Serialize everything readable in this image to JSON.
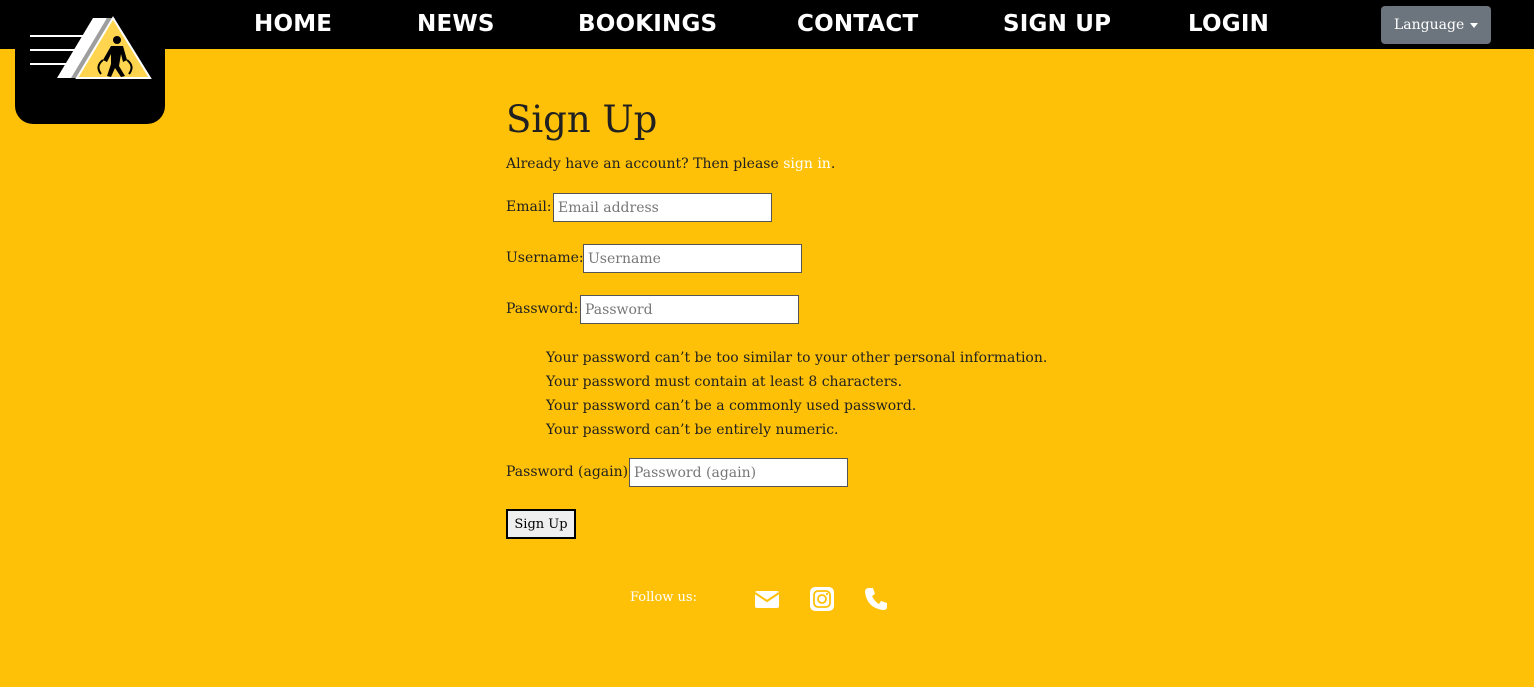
{
  "nav": {
    "items": [
      {
        "label": "HOME"
      },
      {
        "label": "NEWS"
      },
      {
        "label": "BOOKINGS"
      },
      {
        "label": "CONTACT"
      },
      {
        "label": "SIGN UP"
      },
      {
        "label": "LOGIN"
      }
    ],
    "language_label": "Language",
    "logo_icon": "gym-logo-icon"
  },
  "page": {
    "title": "Sign Up",
    "lead_prefix": "Already have an account? Then please ",
    "lead_link": "sign in",
    "lead_suffix": "."
  },
  "form": {
    "email_label": "Email:",
    "email_placeholder": "Email address",
    "username_label": "Username:",
    "username_placeholder": "Username",
    "password_label": "Password:",
    "password_placeholder": "Password",
    "help": [
      "Your password can’t be too similar to your other personal information.",
      "Your password must contain at least 8 characters.",
      "Your password can’t be a commonly used password.",
      "Your password can’t be entirely numeric."
    ],
    "password2_label": "Password (again):",
    "password2_placeholder": "Password (again)",
    "submit_label": "Sign Up"
  },
  "footer": {
    "follow_label": "Follow us:",
    "icons": [
      "envelope-icon",
      "instagram-icon",
      "phone-icon"
    ]
  },
  "colors": {
    "background": "#FFC107",
    "navbar": "#000000",
    "language_button": "#6c757d",
    "link": "#ffffff"
  }
}
